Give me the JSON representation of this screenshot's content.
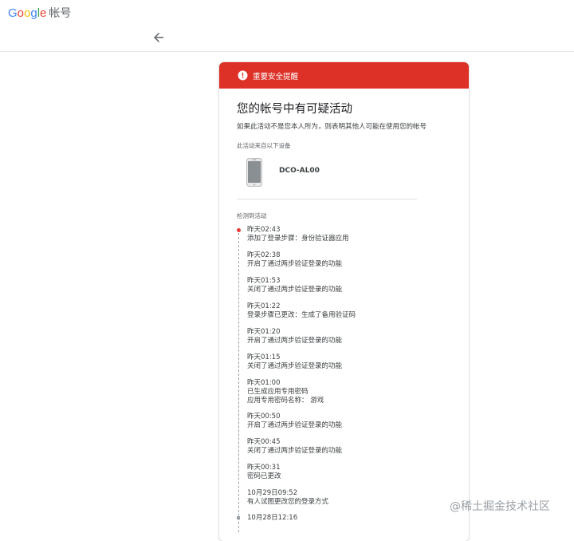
{
  "header": {
    "logo_letters": [
      "G",
      "o",
      "o",
      "g",
      "l",
      "e"
    ],
    "account_label": "帐号"
  },
  "alert": {
    "text": "重要安全提醒"
  },
  "card": {
    "title": "您的帐号中有可疑活动",
    "description": "如果此活动不是您本人所为，则表明其他人可能在使用您的帐号",
    "device_label": "此活动来自以下设备",
    "device_name": "DCO-AL00",
    "activity_label": "检测到活动"
  },
  "events": [
    {
      "time": "昨天02:43",
      "lines": [
        "添加了登录步骤：身份验证器应用"
      ]
    },
    {
      "time": "昨天02:38",
      "lines": [
        "开启了通过两步验证登录的功能"
      ]
    },
    {
      "time": "昨天01:53",
      "lines": [
        "关闭了通过两步验证登录的功能"
      ]
    },
    {
      "time": "昨天01:22",
      "lines": [
        "登录步骤已更改：生成了备用验证码"
      ]
    },
    {
      "time": "昨天01:20",
      "lines": [
        "开启了通过两步验证登录的功能"
      ]
    },
    {
      "time": "昨天01:15",
      "lines": [
        "关闭了通过两步验证登录的功能"
      ]
    },
    {
      "time": "昨天01:00",
      "lines": [
        "已生成应用专用密码",
        "应用专用密码名称：  游戏"
      ]
    },
    {
      "time": "昨天00:50",
      "lines": [
        "开启了通过两步验证登录的功能"
      ]
    },
    {
      "time": "昨天00:45",
      "lines": [
        "关闭了通过两步验证登录的功能"
      ]
    },
    {
      "time": "昨天00:31",
      "lines": [
        "密码已更改"
      ]
    },
    {
      "time": "10月29日09:52",
      "lines": [
        "有人试图更改您的登录方式"
      ]
    },
    {
      "time": "10月28日12:16",
      "lines": []
    }
  ],
  "watermark": "@稀土掘金技术社区",
  "colors": {
    "alert_red": "#dd3127",
    "timeline_dot": "#e53935"
  }
}
